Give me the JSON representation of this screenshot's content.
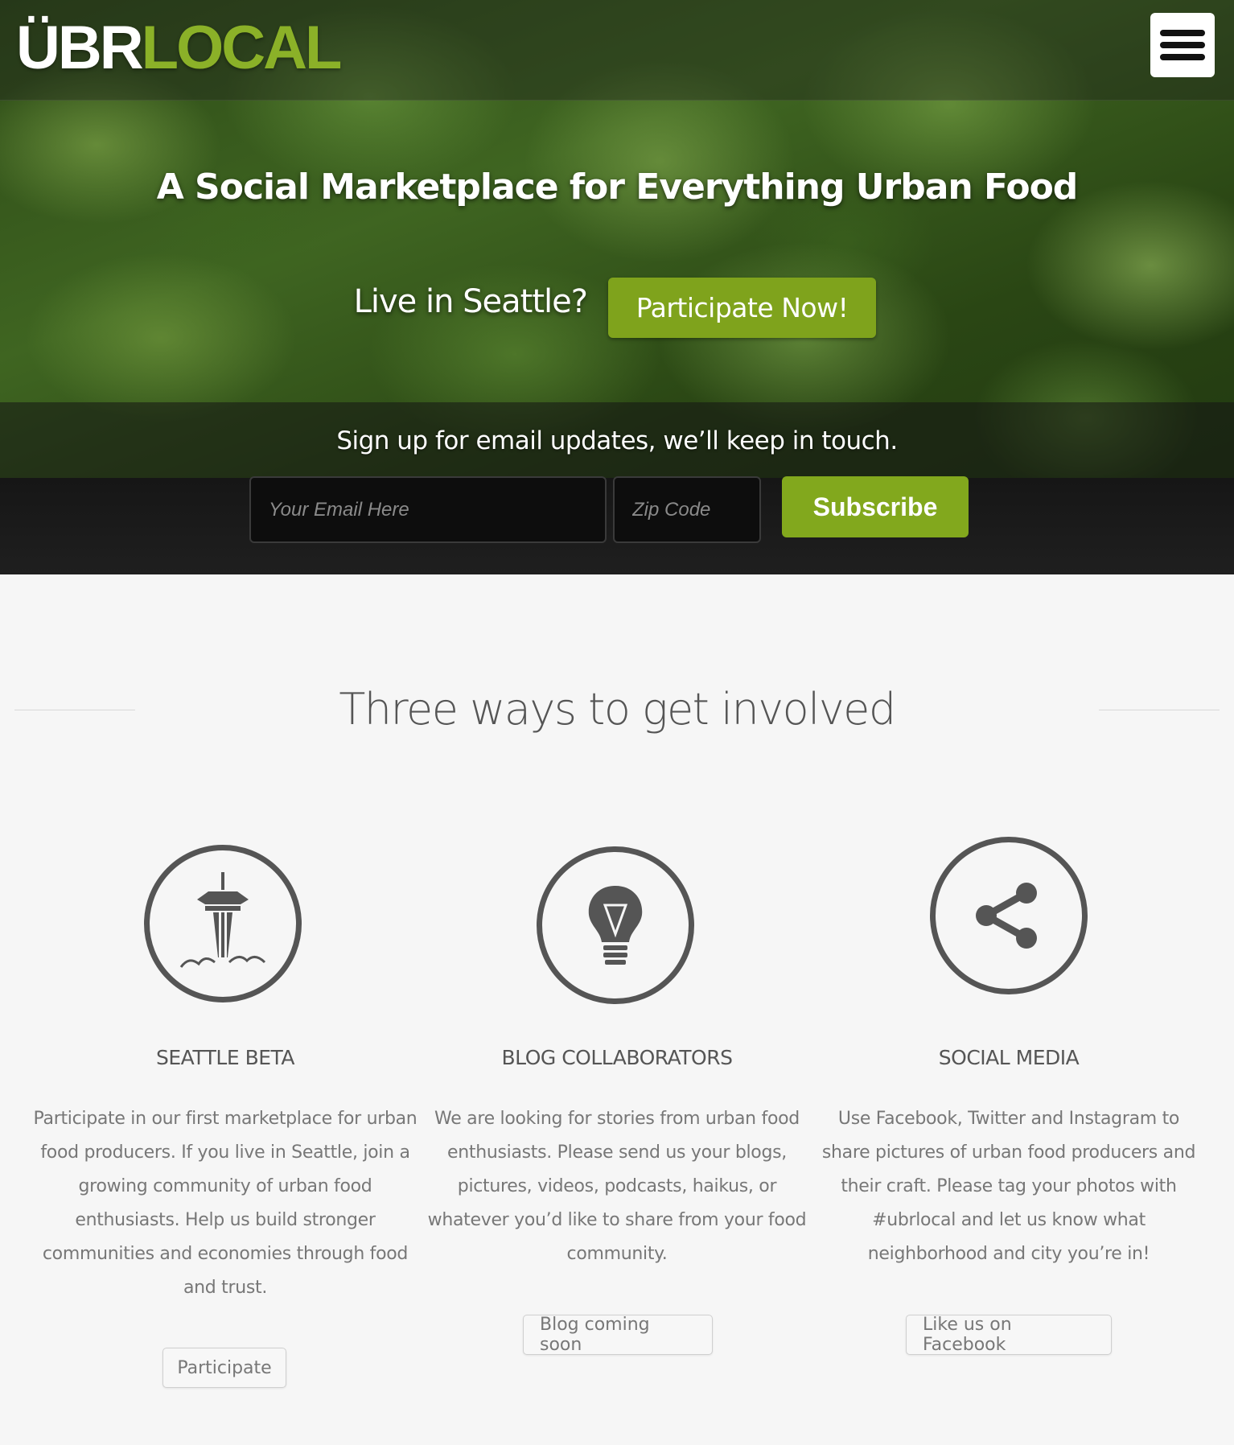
{
  "brand": {
    "logo_white": "ÜBR",
    "logo_green": "LOCAL",
    "accent": "#8bb128",
    "button_green": "#7fa31c"
  },
  "nav": {
    "menu_icon": "hamburger-icon"
  },
  "hero": {
    "title": "A Social Marketplace for Everything Urban Food",
    "cta_prompt": "Live in Seattle?",
    "cta_button": "Participate Now!"
  },
  "signup": {
    "text": "Sign up for email updates, we’ll keep in touch.",
    "email_placeholder": "Your Email Here",
    "zip_placeholder": "Zip Code",
    "subscribe_label": "Subscribe"
  },
  "involved": {
    "title": "Three ways to get involved",
    "columns": [
      {
        "icon": "space-needle-icon",
        "title": "SEATTLE BETA",
        "body": "Participate in our first marketplace for urban food producers. If you live in Seattle, join a growing community of urban food enthusiasts. Help us build stronger communities and economies through food and trust.",
        "button": "Participate"
      },
      {
        "icon": "lightbulb-icon",
        "title": "BLOG COLLABORATORS",
        "body": "We are looking for stories from urban food enthusiasts. Please send us your blogs, pictures, videos, podcasts, haikus, or whatever you’d like to share from your food community.",
        "button": "Blog coming soon"
      },
      {
        "icon": "share-icon",
        "title": "SOCIAL MEDIA",
        "body": "Use Facebook, Twitter and Instagram to share pictures of urban food producers and their craft. Please tag your photos with #ubrlocal and let us know what neighborhood and city you’re in!",
        "button": "Like us on Facebook"
      }
    ]
  }
}
